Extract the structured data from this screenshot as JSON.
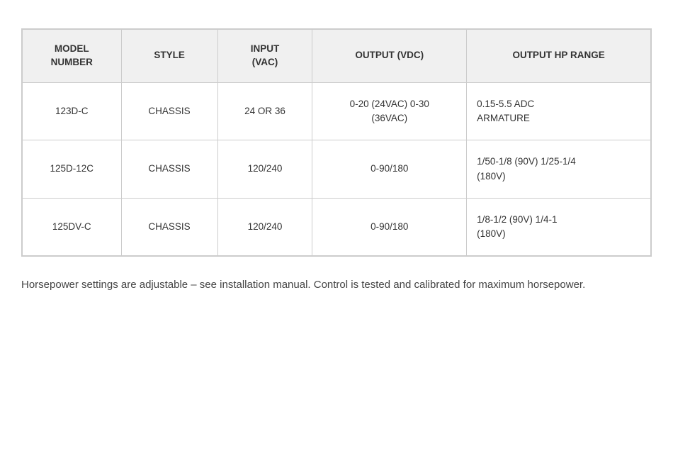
{
  "table": {
    "headers": [
      {
        "id": "model-number",
        "label": "MODEL\nNUMBER"
      },
      {
        "id": "style",
        "label": "STYLE"
      },
      {
        "id": "input-vac",
        "label": "INPUT\n(VAC)"
      },
      {
        "id": "output-vdc",
        "label": "OUTPUT (VDC)"
      },
      {
        "id": "output-hp-range",
        "label": "OUTPUT HP RANGE"
      }
    ],
    "rows": [
      {
        "model": "123D-C",
        "style": "CHASSIS",
        "input": "24 OR 36",
        "output_vdc": "0-20 (24VAC) 0-30\n(36VAC)",
        "output_hp": "0.15-5.5 ADC\nARMATURE"
      },
      {
        "model": "125D-12C",
        "style": "CHASSIS",
        "input": "120/240",
        "output_vdc": "0-90/180",
        "output_hp": "1/50-1/8 (90V) 1/25-1/4\n(180V)"
      },
      {
        "model": "125DV-C",
        "style": "CHASSIS",
        "input": "120/240",
        "output_vdc": "0-90/180",
        "output_hp": "1/8-1/2 (90V) 1/4-1\n(180V)"
      }
    ]
  },
  "footnote": "Horsepower settings are adjustable – see installation manual. Control is tested and calibrated for maximum horsepower."
}
